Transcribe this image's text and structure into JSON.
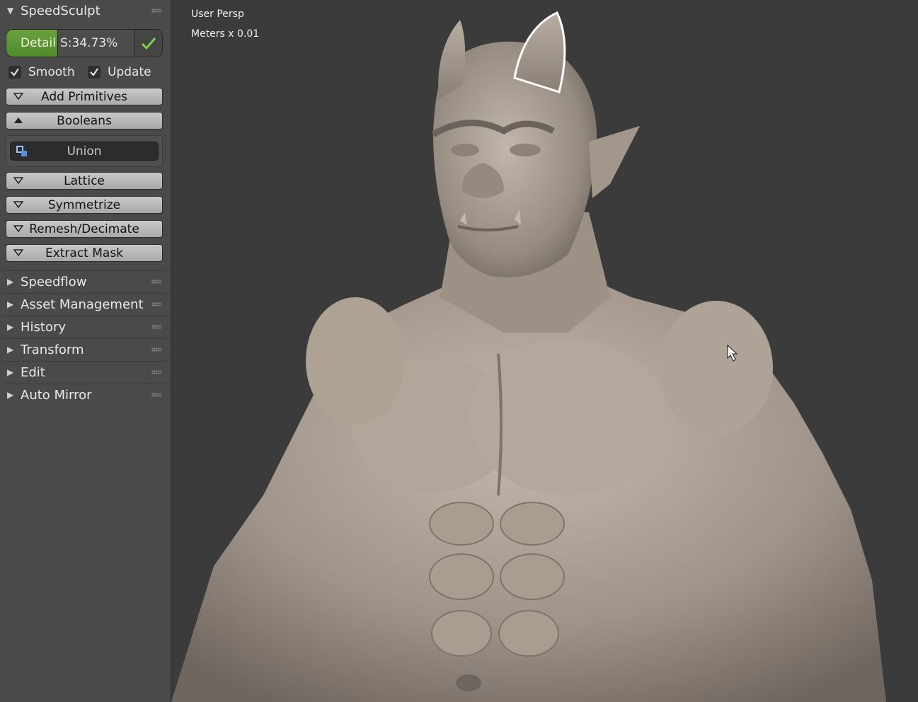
{
  "sidebar": {
    "title": "SpeedSculpt",
    "detail": {
      "label": "Detail",
      "value": "S:34.73%"
    },
    "smooth_label": "Smooth",
    "update_label": "Update",
    "buttons": {
      "add_primitives": "Add Primitives",
      "booleans": "Booleans",
      "union": "Union",
      "lattice": "Lattice",
      "symmetrize": "Symmetrize",
      "remesh": "Remesh/Decimate",
      "extract_mask": "Extract Mask"
    },
    "panels": [
      "Speedflow",
      "Asset Management",
      "History",
      "Transform",
      "Edit",
      "Auto Mirror"
    ]
  },
  "viewport": {
    "view_label": "User Persp",
    "units_label": "Meters x 0.01"
  },
  "colors": {
    "accent_green": "#5e9a35",
    "panel_bg": "#4a4a4a",
    "viewport_bg": "#3b3b3b",
    "skin": "#a59a8e"
  }
}
